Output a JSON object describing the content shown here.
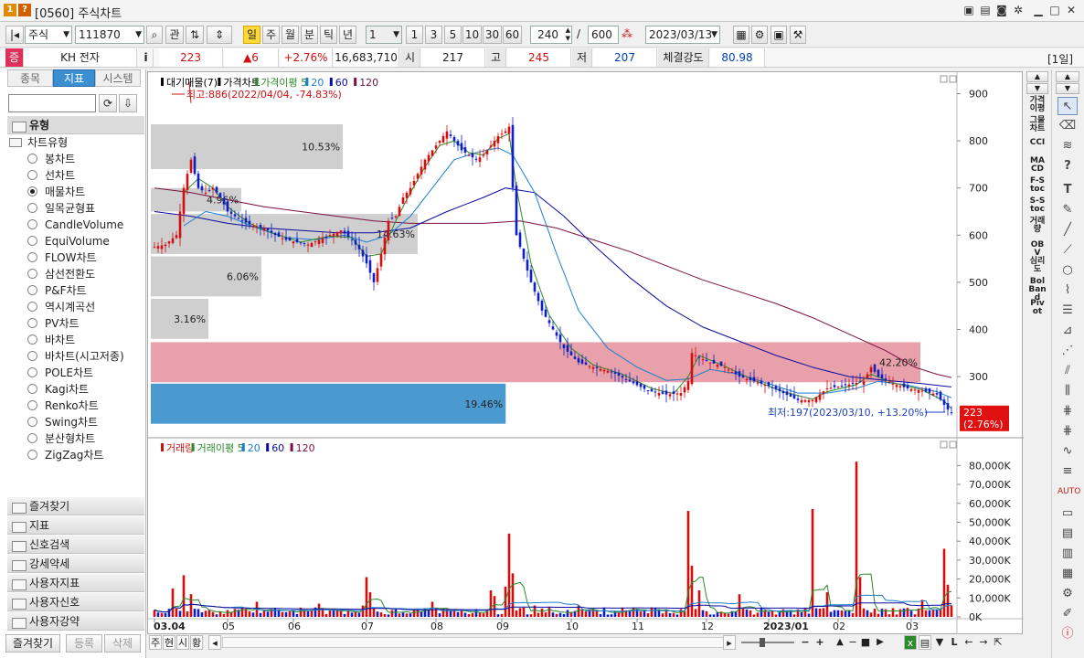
{
  "window": {
    "title": "[0560] 주식차트",
    "num_badge": "1",
    "help_badge": "?"
  },
  "toolbar": {
    "market": "주식",
    "code": "111870",
    "gwan_label": "관",
    "periods": [
      "일",
      "주",
      "월",
      "분",
      "틱",
      "년"
    ],
    "selected_period": "일",
    "multiplier": "1",
    "quick_n": [
      "1",
      "3",
      "5",
      "10",
      "30",
      "60"
    ],
    "view_count": "240",
    "total_count": "600",
    "slash": "/",
    "date": "2023/03/13"
  },
  "quote": {
    "badge": "증",
    "name": "KH 전자",
    "info_icon": "i",
    "price": "223",
    "change": "▲6",
    "change_rate": "+2.76%",
    "volume": "16,683,710",
    "open_label": "시",
    "open": "217",
    "high_label": "고",
    "high": "245",
    "low_label": "저",
    "low": "207",
    "strength_label": "체결강도",
    "strength": "80.98",
    "period_tag": "[1일]"
  },
  "left_panel": {
    "tabs": [
      "종목",
      "지표",
      "시스템"
    ],
    "selected_tab": "지표",
    "group_header": "유형",
    "group_title": "차트유형",
    "chart_types": [
      "봉차트",
      "선차트",
      "매물차트",
      "일목균형표",
      "CandleVolume",
      "EquiVolume",
      "FLOW차트",
      "삼선전환도",
      "P&F차트",
      "역시계곡선",
      "PV차트",
      "바차트",
      "바차트(시고저종)",
      "POLE차트",
      "Kagi차트",
      "Renko차트",
      "Swing차트",
      "분산형차트",
      "ZigZag차트"
    ],
    "selected_type": "매물차트",
    "folders": [
      "즐겨찾기",
      "지표",
      "신호검색",
      "강세약세",
      "사용자지표",
      "사용자신호",
      "사용자강약"
    ],
    "bottom_buttons": [
      "즐겨찾기",
      "등록",
      "삭제"
    ]
  },
  "price_panel": {
    "legend": [
      "대기매물(7)",
      "가격차트",
      "가격이평 5",
      "20",
      "60",
      "120"
    ],
    "legend_colors": [
      "#000000",
      "#000000",
      "#2a8a2a",
      "#1a7fd0",
      "#0a0aa0",
      "#7a1040"
    ],
    "max_note": "최고:886(2022/04/04, -74.83%)",
    "min_note": "최저:197(2023/03/10, +13.20%)",
    "price_tag": "223",
    "price_tag_rate": "(2.76%)",
    "y_ticks": [
      "900",
      "800",
      "700",
      "600",
      "500",
      "400",
      "300"
    ]
  },
  "volume_panel": {
    "legend": [
      "거래량",
      "거래이평 5",
      "20",
      "60",
      "120"
    ],
    "legend_colors": [
      "#d01010",
      "#2a8a2a",
      "#1a7fd0",
      "#0a0aa0",
      "#7a1040"
    ],
    "y_ticks": [
      "80,000K",
      "70,000K",
      "60,000K",
      "50,000K",
      "40,000K",
      "30,000K",
      "20,000K",
      "10,000K",
      "0K"
    ]
  },
  "x_ticks": [
    "03.04",
    "05",
    "06",
    "07",
    "08",
    "09",
    "10",
    "11",
    "12",
    "2023/01",
    "02",
    "03"
  ],
  "bottom_bar": {
    "buttons": [
      "주",
      "현",
      "시",
      "황"
    ],
    "zoom_minus": "−",
    "zoom_plus": "+"
  },
  "right_indicators": [
    "가격이평",
    "그물차트",
    "CCI",
    "MACD",
    "F-Stoc",
    "S-Stoc",
    "거래량",
    "OBV",
    "심리도",
    "Bol Band",
    "Pivot"
  ],
  "chart_data": {
    "type": "candlestick",
    "price_range": [
      180,
      930
    ],
    "volume_range": [
      0,
      85000
    ],
    "volume_unit": "K",
    "volume_profile": {
      "label_count": "7",
      "bands": [
        {
          "low": 740,
          "high": 835,
          "pct": "10.53%"
        },
        {
          "low": 650,
          "high": 700,
          "pct": "4.96%"
        },
        {
          "low": 560,
          "high": 645,
          "pct": "14.63%"
        },
        {
          "low": 470,
          "high": 555,
          "pct": "6.06%"
        },
        {
          "low": 380,
          "high": 465,
          "pct": "3.16%"
        },
        {
          "low": 288,
          "high": 373,
          "pct": "42.20%"
        },
        {
          "low": 200,
          "high": 285,
          "pct": "19.46%"
        }
      ]
    },
    "price_path": [
      [
        0,
        575
      ],
      [
        3,
        580
      ],
      [
        6,
        600
      ],
      [
        8,
        700
      ],
      [
        10,
        760
      ],
      [
        12,
        700
      ],
      [
        14,
        690
      ],
      [
        16,
        700
      ],
      [
        18,
        680
      ],
      [
        20,
        650
      ],
      [
        22,
        640
      ],
      [
        24,
        630
      ],
      [
        27,
        620
      ],
      [
        30,
        615
      ],
      [
        33,
        600
      ],
      [
        36,
        590
      ],
      [
        39,
        585
      ],
      [
        42,
        580
      ],
      [
        45,
        590
      ],
      [
        48,
        600
      ],
      [
        51,
        610
      ],
      [
        54,
        590
      ],
      [
        56,
        570
      ],
      [
        58,
        540
      ],
      [
        60,
        500
      ],
      [
        62,
        560
      ],
      [
        64,
        630
      ],
      [
        66,
        640
      ],
      [
        68,
        680
      ],
      [
        70,
        700
      ],
      [
        72,
        730
      ],
      [
        74,
        760
      ],
      [
        76,
        780
      ],
      [
        78,
        800
      ],
      [
        80,
        820
      ],
      [
        82,
        800
      ],
      [
        84,
        780
      ],
      [
        86,
        770
      ],
      [
        88,
        760
      ],
      [
        90,
        770
      ],
      [
        92,
        790
      ],
      [
        94,
        810
      ],
      [
        96,
        820
      ],
      [
        97,
        830
      ],
      [
        98,
        700
      ],
      [
        99,
        600
      ],
      [
        101,
        550
      ],
      [
        103,
        500
      ],
      [
        106,
        440
      ],
      [
        109,
        400
      ],
      [
        112,
        360
      ],
      [
        116,
        330
      ],
      [
        120,
        320
      ],
      [
        125,
        310
      ],
      [
        130,
        290
      ],
      [
        135,
        270
      ],
      [
        140,
        262
      ],
      [
        144,
        265
      ],
      [
        146,
        290
      ],
      [
        147,
        350
      ],
      [
        149,
        340
      ],
      [
        152,
        330
      ],
      [
        156,
        320
      ],
      [
        160,
        300
      ],
      [
        164,
        290
      ],
      [
        168,
        280
      ],
      [
        172,
        265
      ],
      [
        176,
        250
      ],
      [
        180,
        250
      ],
      [
        184,
        275
      ],
      [
        188,
        280
      ],
      [
        191,
        285
      ],
      [
        194,
        290
      ],
      [
        196,
        320
      ],
      [
        198,
        300
      ],
      [
        202,
        285
      ],
      [
        206,
        275
      ],
      [
        210,
        270
      ],
      [
        214,
        262
      ],
      [
        216,
        240
      ],
      [
        217,
        230
      ],
      [
        218,
        223
      ]
    ],
    "ma5_path": [
      [
        8,
        690
      ],
      [
        12,
        720
      ],
      [
        16,
        700
      ],
      [
        20,
        660
      ],
      [
        26,
        625
      ],
      [
        32,
        605
      ],
      [
        40,
        585
      ],
      [
        48,
        598
      ],
      [
        54,
        595
      ],
      [
        58,
        555
      ],
      [
        62,
        560
      ],
      [
        66,
        630
      ],
      [
        70,
        690
      ],
      [
        74,
        745
      ],
      [
        78,
        790
      ],
      [
        82,
        800
      ],
      [
        86,
        775
      ],
      [
        90,
        770
      ],
      [
        94,
        805
      ],
      [
        97,
        815
      ],
      [
        99,
        700
      ],
      [
        103,
        540
      ],
      [
        108,
        430
      ],
      [
        114,
        360
      ],
      [
        120,
        325
      ],
      [
        128,
        305
      ],
      [
        136,
        275
      ],
      [
        142,
        264
      ],
      [
        146,
        300
      ],
      [
        149,
        345
      ],
      [
        156,
        322
      ],
      [
        164,
        292
      ],
      [
        172,
        268
      ],
      [
        180,
        252
      ],
      [
        184,
        268
      ],
      [
        192,
        283
      ],
      [
        196,
        305
      ],
      [
        202,
        287
      ],
      [
        210,
        272
      ],
      [
        216,
        248
      ],
      [
        218,
        232
      ]
    ],
    "ma20_path": [
      [
        8,
        620
      ],
      [
        14,
        650
      ],
      [
        20,
        640
      ],
      [
        28,
        615
      ],
      [
        36,
        595
      ],
      [
        44,
        590
      ],
      [
        52,
        600
      ],
      [
        58,
        585
      ],
      [
        64,
        600
      ],
      [
        70,
        640
      ],
      [
        76,
        700
      ],
      [
        82,
        760
      ],
      [
        88,
        775
      ],
      [
        94,
        785
      ],
      [
        98,
        770
      ],
      [
        104,
        690
      ],
      [
        110,
        560
      ],
      [
        116,
        440
      ],
      [
        124,
        360
      ],
      [
        132,
        320
      ],
      [
        140,
        292
      ],
      [
        146,
        295
      ],
      [
        152,
        315
      ],
      [
        160,
        305
      ],
      [
        168,
        285
      ],
      [
        176,
        265
      ],
      [
        184,
        265
      ],
      [
        192,
        275
      ],
      [
        198,
        290
      ],
      [
        206,
        282
      ],
      [
        214,
        268
      ],
      [
        218,
        255
      ]
    ],
    "ma60_path": [
      [
        0,
        650
      ],
      [
        10,
        640
      ],
      [
        20,
        625
      ],
      [
        30,
        615
      ],
      [
        40,
        610
      ],
      [
        50,
        605
      ],
      [
        60,
        605
      ],
      [
        70,
        615
      ],
      [
        80,
        650
      ],
      [
        90,
        680
      ],
      [
        96,
        700
      ],
      [
        104,
        690
      ],
      [
        112,
        640
      ],
      [
        120,
        580
      ],
      [
        130,
        510
      ],
      [
        140,
        450
      ],
      [
        150,
        405
      ],
      [
        160,
        375
      ],
      [
        170,
        345
      ],
      [
        180,
        320
      ],
      [
        190,
        300
      ],
      [
        200,
        292
      ],
      [
        210,
        285
      ],
      [
        218,
        278
      ]
    ],
    "ma120_path": [
      [
        0,
        700
      ],
      [
        10,
        690
      ],
      [
        20,
        675
      ],
      [
        30,
        660
      ],
      [
        40,
        650
      ],
      [
        50,
        640
      ],
      [
        60,
        630
      ],
      [
        70,
        625
      ],
      [
        80,
        625
      ],
      [
        90,
        625
      ],
      [
        100,
        630
      ],
      [
        110,
        615
      ],
      [
        120,
        590
      ],
      [
        130,
        565
      ],
      [
        140,
        535
      ],
      [
        150,
        505
      ],
      [
        160,
        480
      ],
      [
        170,
        455
      ],
      [
        180,
        425
      ],
      [
        190,
        390
      ],
      [
        200,
        355
      ],
      [
        208,
        320
      ],
      [
        214,
        305
      ],
      [
        218,
        298
      ]
    ],
    "volume_spikes": [
      [
        5,
        15000
      ],
      [
        8,
        22000
      ],
      [
        10,
        12000
      ],
      [
        28,
        8000
      ],
      [
        45,
        7000
      ],
      [
        57,
        6000
      ],
      [
        58,
        21000
      ],
      [
        59,
        13000
      ],
      [
        76,
        8000
      ],
      [
        92,
        14000
      ],
      [
        93,
        11000
      ],
      [
        96,
        16000
      ],
      [
        97,
        44000
      ],
      [
        98,
        23000
      ],
      [
        104,
        6000
      ],
      [
        116,
        6000
      ],
      [
        136,
        5000
      ],
      [
        146,
        56000
      ],
      [
        147,
        27000
      ],
      [
        149,
        14000
      ],
      [
        160,
        12000
      ],
      [
        176,
        4000
      ],
      [
        180,
        57000
      ],
      [
        184,
        13000
      ],
      [
        192,
        82000
      ],
      [
        193,
        21000
      ],
      [
        210,
        9000
      ],
      [
        216,
        36000
      ],
      [
        217,
        17000
      ],
      [
        218,
        6000
      ]
    ],
    "n_bars": 219
  }
}
